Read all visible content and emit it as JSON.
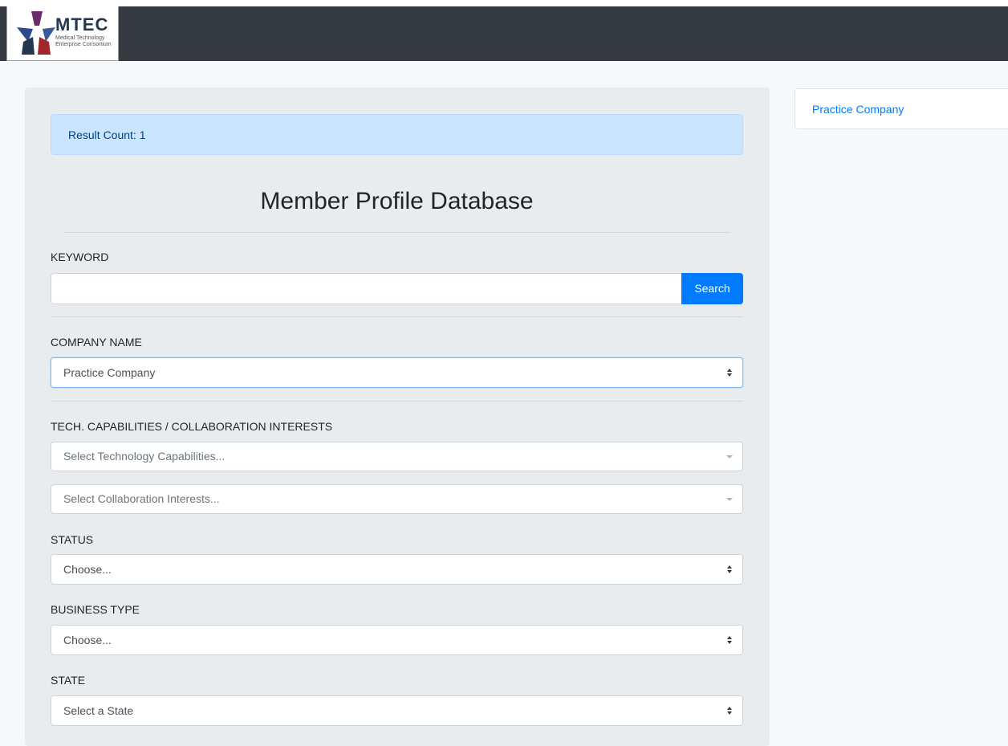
{
  "brand": {
    "title": "MTEC",
    "subtitle_line1": "Medical Technology",
    "subtitle_line2": "Enterprise Consortium"
  },
  "alert": {
    "text": "Result Count: 1"
  },
  "page": {
    "title": "Member Profile Database"
  },
  "form": {
    "keyword": {
      "label": "KEYWORD",
      "value": "",
      "button": "Search"
    },
    "company": {
      "label": "COMPANY NAME",
      "value": "Practice Company"
    },
    "tech": {
      "label": "TECH. CAPABILITIES / COLLABORATION INTERESTS",
      "tech_placeholder": "Select Technology Capabilities...",
      "collab_placeholder": "Select Collaboration Interests..."
    },
    "status": {
      "label": "STATUS",
      "value": "Choose..."
    },
    "business_type": {
      "label": "BUSINESS TYPE",
      "value": "Choose..."
    },
    "state": {
      "label": "STATE",
      "value": "Select a State"
    }
  },
  "results": [
    {
      "name": "Practice Company"
    }
  ],
  "colors": {
    "navbar": "#343a40",
    "primary": "#007bff",
    "alert_bg": "#cce5ff",
    "alert_text": "#004085",
    "panel_bg": "#e9ecef"
  }
}
